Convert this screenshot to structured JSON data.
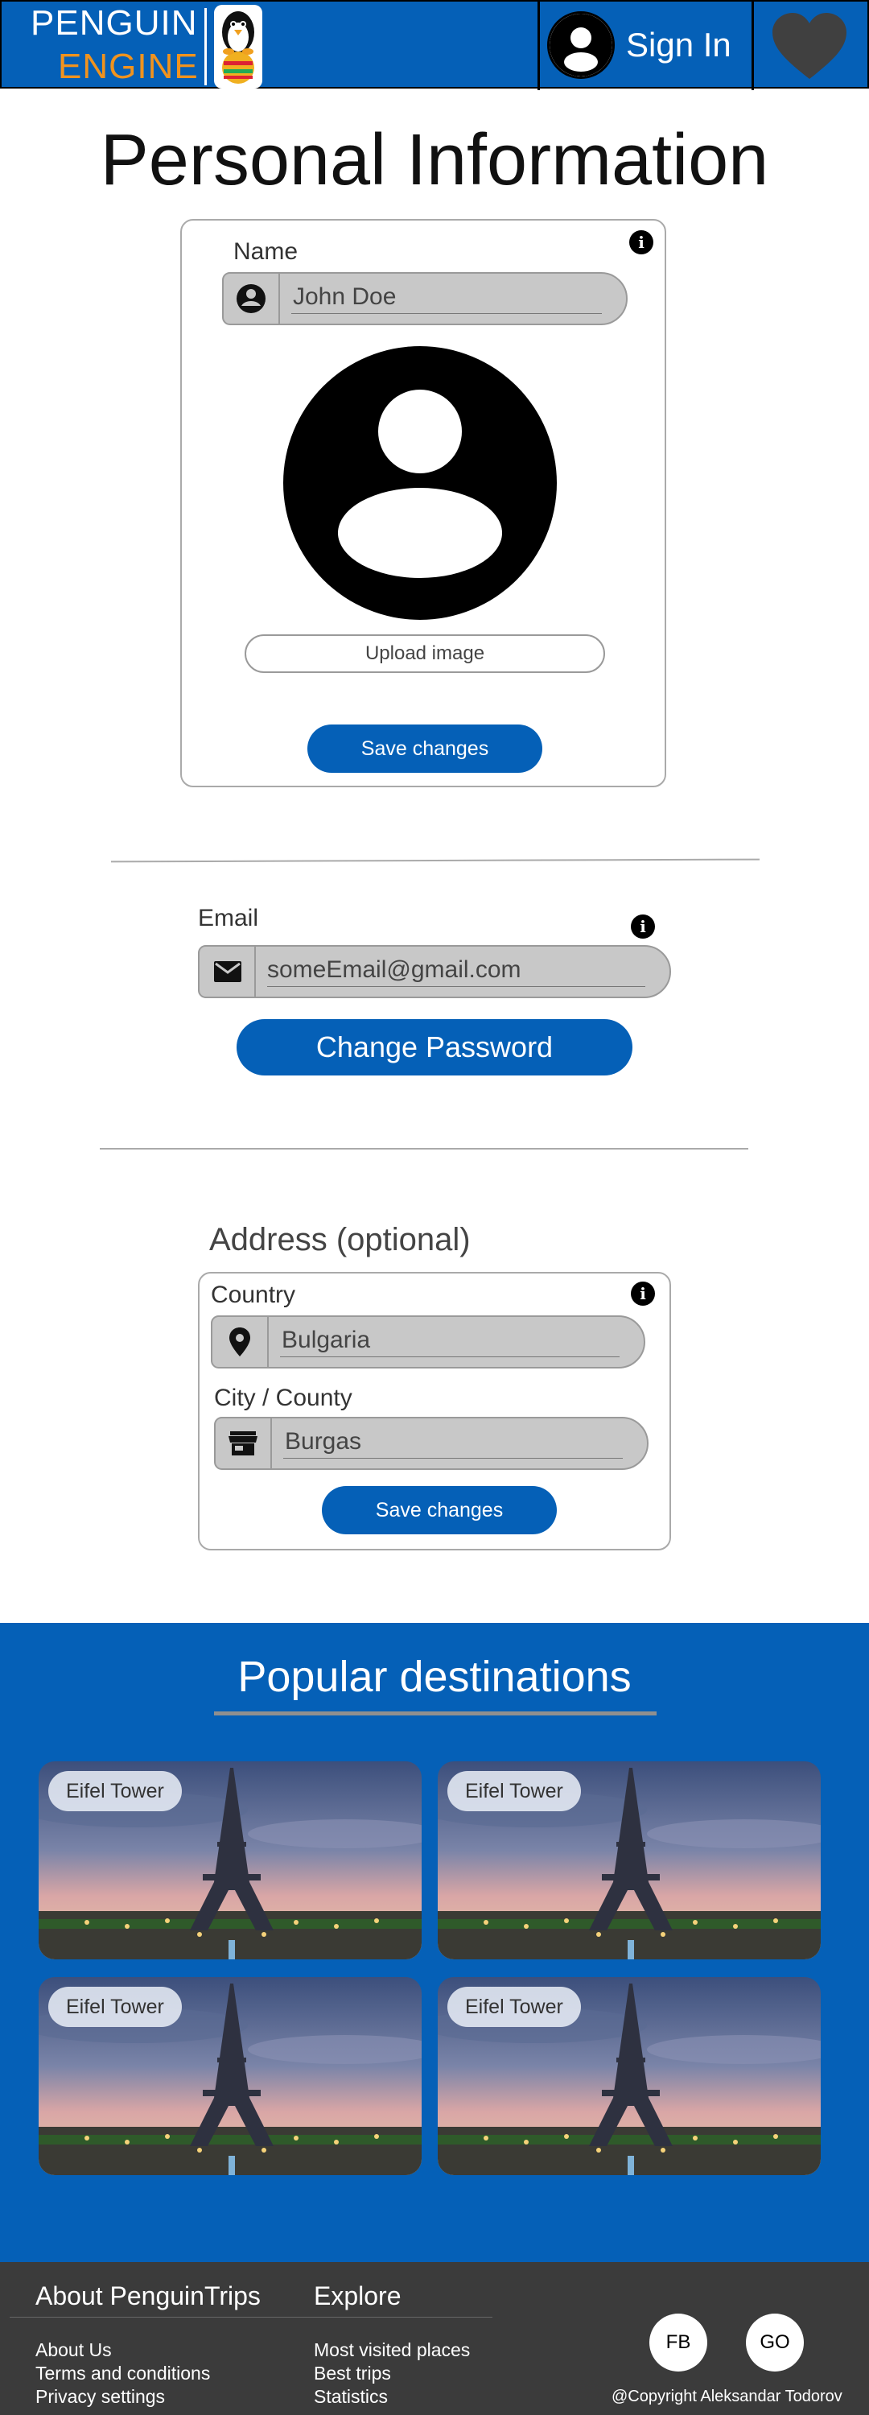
{
  "header": {
    "logo_top": "PENGUIN",
    "logo_bottom": "ENGINE",
    "signin_label": "Sign In"
  },
  "page_title": "Personal Information",
  "personal": {
    "name_label": "Name",
    "name_value": "John Doe",
    "upload_label": "Upload image",
    "save_label": "Save changes",
    "info_glyph": "i"
  },
  "account": {
    "email_label": "Email",
    "email_value": "someEmail@gmail.com",
    "change_password_label": "Change Password",
    "info_glyph": "i"
  },
  "address": {
    "title": "Address (optional)",
    "country_label": "Country",
    "country_value": "Bulgaria",
    "city_label": "City / County",
    "city_value": "Burgas",
    "save_label": "Save changes",
    "info_glyph": "i"
  },
  "popular": {
    "title": "Popular destinations",
    "tiles": [
      {
        "label": "Eifel Tower"
      },
      {
        "label": "Eifel Tower"
      },
      {
        "label": "Eifel Tower"
      },
      {
        "label": "Eifel Tower"
      }
    ]
  },
  "footer": {
    "about_heading": "About PenguinTrips",
    "about_links": [
      "About Us",
      "Terms and conditions",
      "Privacy settings"
    ],
    "explore_heading": "Explore",
    "explore_links": [
      "Most visited places",
      "Best trips",
      "Statistics"
    ],
    "social": [
      "FB",
      "GO"
    ],
    "copyright": "@Copyright Aleksandar Todorov"
  },
  "colors": {
    "brand_blue": "#0560b7",
    "logo_orange": "#f0931e",
    "footer_bg": "#3b3b3b"
  },
  "icons": [
    "penguin-logo-icon",
    "user-avatar-icon",
    "heart-icon",
    "info-icon",
    "account-circle-icon",
    "mail-icon",
    "location-pin-icon",
    "store-icon"
  ]
}
